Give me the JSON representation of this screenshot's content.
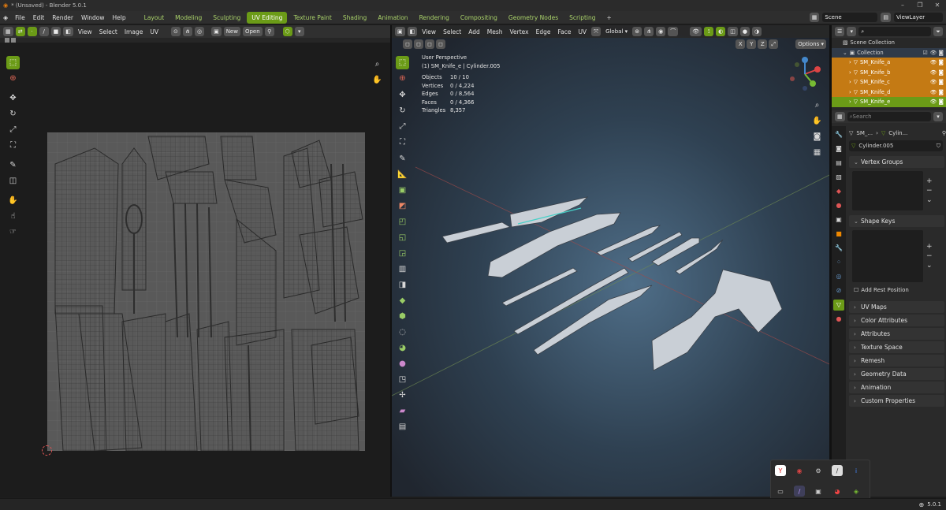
{
  "window": {
    "title": "* (Unsaved) - Blender 5.0.1",
    "controls": [
      "–",
      "❐",
      "✕"
    ]
  },
  "menu": [
    "File",
    "Edit",
    "Render",
    "Window",
    "Help"
  ],
  "workspaces": [
    "Layout",
    "Modeling",
    "Sculpting",
    "UV Editing",
    "Texture Paint",
    "Shading",
    "Animation",
    "Rendering",
    "Compositing",
    "Geometry Nodes",
    "Scripting"
  ],
  "active_workspace": "UV Editing",
  "add_workspace": "+",
  "scene": {
    "label": "Scene",
    "view_layer": "ViewLayer"
  },
  "uv_header": {
    "menus": [
      "View",
      "Select",
      "Image",
      "UV"
    ],
    "new_label": "New",
    "open_label": "Open"
  },
  "viewport_header": {
    "menus": [
      "View",
      "Select",
      "Add",
      "Mesh",
      "Vertex",
      "Edge",
      "Face",
      "UV"
    ],
    "orientation": "Global",
    "options": "Options",
    "axes": [
      "X",
      "Y",
      "Z"
    ]
  },
  "viewport_overlay": {
    "perspective": "User Perspective",
    "object_info": "(1) SM_Knife_e | Cylinder.005",
    "stats": [
      {
        "label": "Objects",
        "value": "10 / 10"
      },
      {
        "label": "Vertices",
        "value": "0 / 4,224"
      },
      {
        "label": "Edges",
        "value": "0 / 8,564"
      },
      {
        "label": "Faces",
        "value": "0 / 4,366"
      },
      {
        "label": "Triangles",
        "value": "8,357"
      }
    ]
  },
  "outliner": {
    "search_placeholder": "",
    "root": "Scene Collection",
    "collection": "Collection",
    "items": [
      {
        "name": "SM_Knife_a",
        "state": "selected"
      },
      {
        "name": "SM_Knife_b",
        "state": "selected"
      },
      {
        "name": "SM_Knife_c",
        "state": "selected"
      },
      {
        "name": "SM_Knife_d",
        "state": "selected"
      },
      {
        "name": "SM_Knife_e",
        "state": "active"
      }
    ]
  },
  "properties": {
    "search_placeholder": "Search",
    "breadcrumb": [
      "SM_...",
      "Cylin..."
    ],
    "data_name": "Cylinder.005",
    "vertex_groups": "Vertex Groups",
    "shape_keys": "Shape Keys",
    "add_rest_position": "Add Rest Position",
    "panels": [
      "UV Maps",
      "Color Attributes",
      "Attributes",
      "Texture Space",
      "Remesh",
      "Geometry Data",
      "Animation",
      "Custom Properties"
    ]
  },
  "status": {
    "version": "5.0.1"
  },
  "colors": {
    "accent": "#6b9b17",
    "selected": "#c47a14",
    "background": "#1d1d1d"
  }
}
